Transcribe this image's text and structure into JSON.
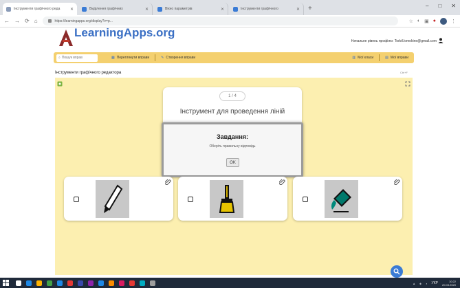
{
  "browser": {
    "tabs": [
      {
        "label": "Інструменти графічного реда",
        "active": true,
        "color": "#8a9bb8"
      },
      {
        "label": "Виділення графічних",
        "active": false,
        "color": "#3a7bd5"
      },
      {
        "label": "Вікно параметрів",
        "active": false,
        "color": "#3a7bd5"
      },
      {
        "label": "Інструменти графічного",
        "active": false,
        "color": "#3a7bd5"
      }
    ],
    "new_tab": "+",
    "window_controls": [
      "–",
      "□",
      "✕"
    ],
    "url": "https://learningapps.org/display?v=p...",
    "nav": [
      "←",
      "→",
      "⟳",
      "⌂"
    ]
  },
  "site": {
    "logo": "LearningApps.org",
    "user_email": "Начальне рівень профілю: Torbil.lomokine@gmail.com",
    "search_placeholder": "Пошук вправ",
    "nav": {
      "browse": "Переглянути вправи",
      "create": "Створення вправи",
      "my_classes": "Мої класи",
      "my_apps": "Мої вправи"
    }
  },
  "page": {
    "title": "Інструменти графічного редактора",
    "fullscreen": "Ctrl+F"
  },
  "app": {
    "counter": "1 / 4",
    "tool_title": "Інструмент для проведення ліній",
    "task": {
      "title": "Завдання:",
      "text": "Оберіть правильну відповідь",
      "ok": "OK"
    },
    "cards": [
      {
        "icon": "pencil-tool-icon"
      },
      {
        "icon": "brush-tool-icon"
      },
      {
        "icon": "paint-bucket-tool-icon"
      }
    ]
  },
  "taskbar": {
    "icon_colors": [
      "#ffffff",
      "#1e88e5",
      "#ffb300",
      "#43a047",
      "#1e88e5",
      "#e53935",
      "#3949ab",
      "#8e24aa",
      "#1e88e5",
      "#fb8c00",
      "#d81b60",
      "#e53935",
      "#00acc1",
      "#9e9e9e"
    ],
    "lang": "УКР",
    "time": "10:22",
    "date": "20.03.2020"
  },
  "colors": {
    "accent": "#f4d06f",
    "app_bg": "#fcefb0",
    "logo": "#3a6fc4"
  }
}
